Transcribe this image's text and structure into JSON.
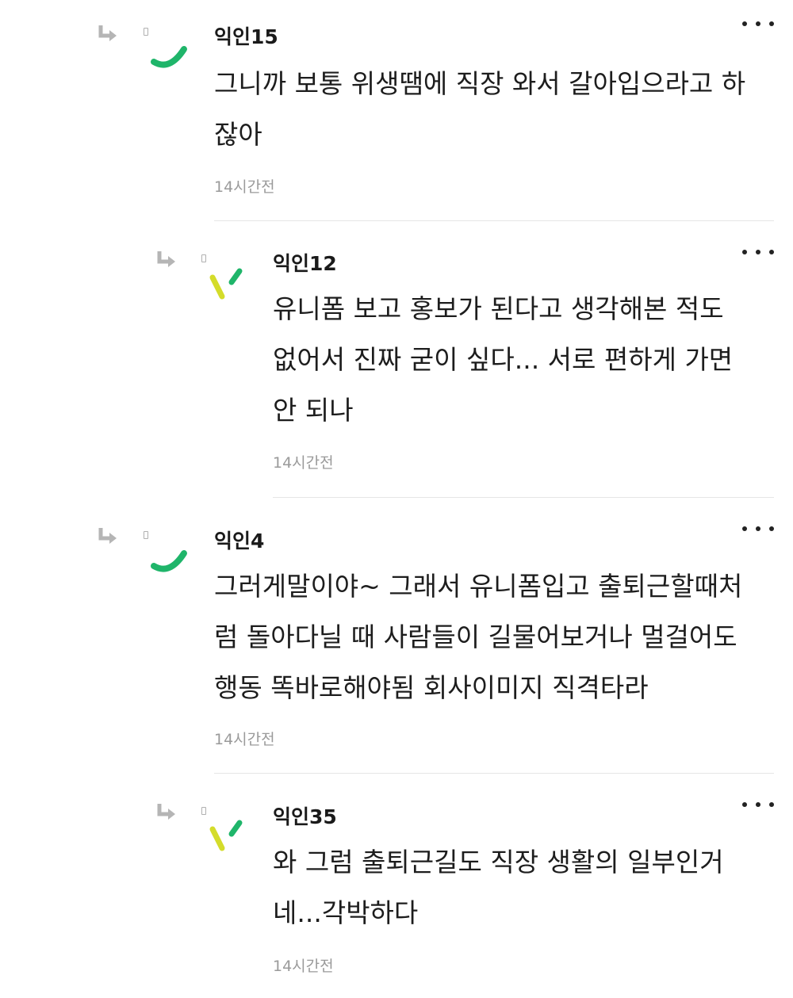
{
  "comments": [
    {
      "author": "익인15",
      "lines": [
        "그니까 보통 위생땜에 직장 와서 갈아입으라고 하",
        "잖아"
      ],
      "time": "14시간전",
      "avatar_color": "#1fb56a"
    },
    {
      "author": "익인12",
      "lines": [
        "유니폼 보고 홍보가 된다고 생각해본 적도",
        "없어서 진짜 굳이 싶다... 서로 편하게 가면",
        "안 되나"
      ],
      "time": "14시간전",
      "avatar_colors": [
        "#d4dc2a",
        "#1fb56a"
      ]
    },
    {
      "author": "익인4",
      "lines": [
        "그러게말이야~ 그래서 유니폼입고 출퇴근할때처",
        "럼 돌아다닐 때 사람들이 길물어보거나 멀걸어도",
        "행동 똑바로해야됨 회사이미지 직격타라"
      ],
      "time": "14시간전",
      "avatar_color": "#1fb56a"
    },
    {
      "author": "익인35",
      "lines": [
        "와 그럼 출퇴근길도 직장 생활의 일부인거",
        "네...각박하다"
      ],
      "time": "14시간전",
      "avatar_colors": [
        "#d4dc2a",
        "#1fb56a"
      ]
    }
  ]
}
